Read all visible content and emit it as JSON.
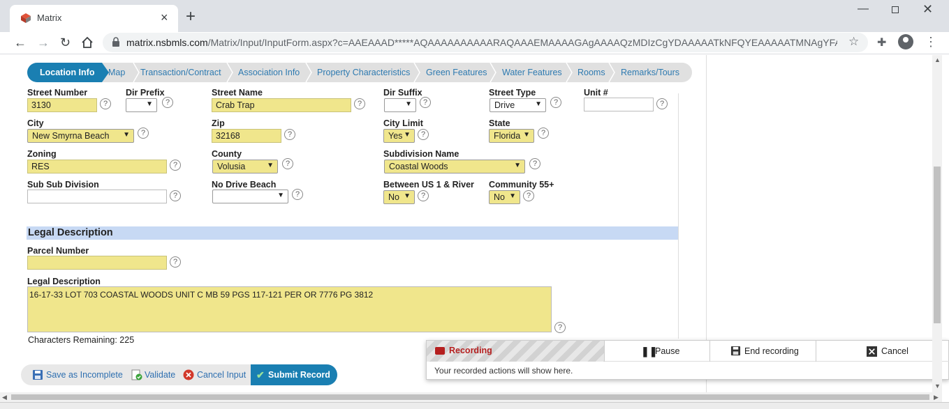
{
  "browser": {
    "tab_title": "Matrix",
    "tab_close": "×",
    "new_tab": "+",
    "url_host": "matrix.nsbmls.com",
    "url_path": "/Matrix/Input/InputForm.aspx?c=AAEAAAD*****AQAAAAAAAAAARAQAAAEMAAAAGAgAAAAQzMDIzCgYDAAAAATkNFQYEAAAAATMNAgYFAAA..."
  },
  "steps": [
    "Location Info",
    "Map",
    "Transaction/Contract",
    "Association Info",
    "Property Characteristics",
    "Green Features",
    "Water Features",
    "Rooms",
    "Remarks/Tours"
  ],
  "fields": {
    "street_number": {
      "label": "Street Number",
      "value": "3130"
    },
    "dir_prefix": {
      "label": "Dir Prefix",
      "value": ""
    },
    "street_name": {
      "label": "Street Name",
      "value": "Crab Trap"
    },
    "dir_suffix": {
      "label": "Dir Suffix",
      "value": ""
    },
    "street_type": {
      "label": "Street Type",
      "value": "Drive"
    },
    "unit": {
      "label": "Unit #",
      "value": ""
    },
    "city": {
      "label": "City",
      "value": "New Smyrna Beach"
    },
    "zip": {
      "label": "Zip",
      "value": "32168"
    },
    "city_limit": {
      "label": "City Limit",
      "value": "Yes"
    },
    "state": {
      "label": "State",
      "value": "Florida"
    },
    "zoning": {
      "label": "Zoning",
      "value": "RES"
    },
    "county": {
      "label": "County",
      "value": "Volusia"
    },
    "subdivision": {
      "label": "Subdivision Name",
      "value": "Coastal Woods"
    },
    "sub_sub_division": {
      "label": "Sub Sub Division",
      "value": ""
    },
    "no_drive_beach": {
      "label": "No Drive Beach",
      "value": ""
    },
    "between_us1": {
      "label": "Between US 1 & River",
      "value": "No"
    },
    "community55": {
      "label": "Community 55+",
      "value": "No"
    }
  },
  "legal": {
    "section_title": "Legal Description",
    "parcel_label": "Parcel Number",
    "parcel_value": "",
    "desc_label": "Legal Description",
    "desc_value": "16-17-33 LOT 703 COASTAL WOODS UNIT C MB 59 PGS 117-121 PER OR 7776 PG 3812",
    "chars_remaining": "Characters Remaining: 225"
  },
  "actions": {
    "save": "Save as Incomplete",
    "validate": "Validate",
    "cancel": "Cancel Input",
    "submit": "Submit Record"
  },
  "recording": {
    "status": "Recording",
    "pause": "Pause",
    "end": "End recording",
    "cancel": "Cancel",
    "message": "Your recorded actions will show here."
  },
  "colors": {
    "accent": "#1a7fb2",
    "required_field": "#f0e68c",
    "section_bar": "#c7d9f4",
    "recording_red": "#b52020"
  }
}
